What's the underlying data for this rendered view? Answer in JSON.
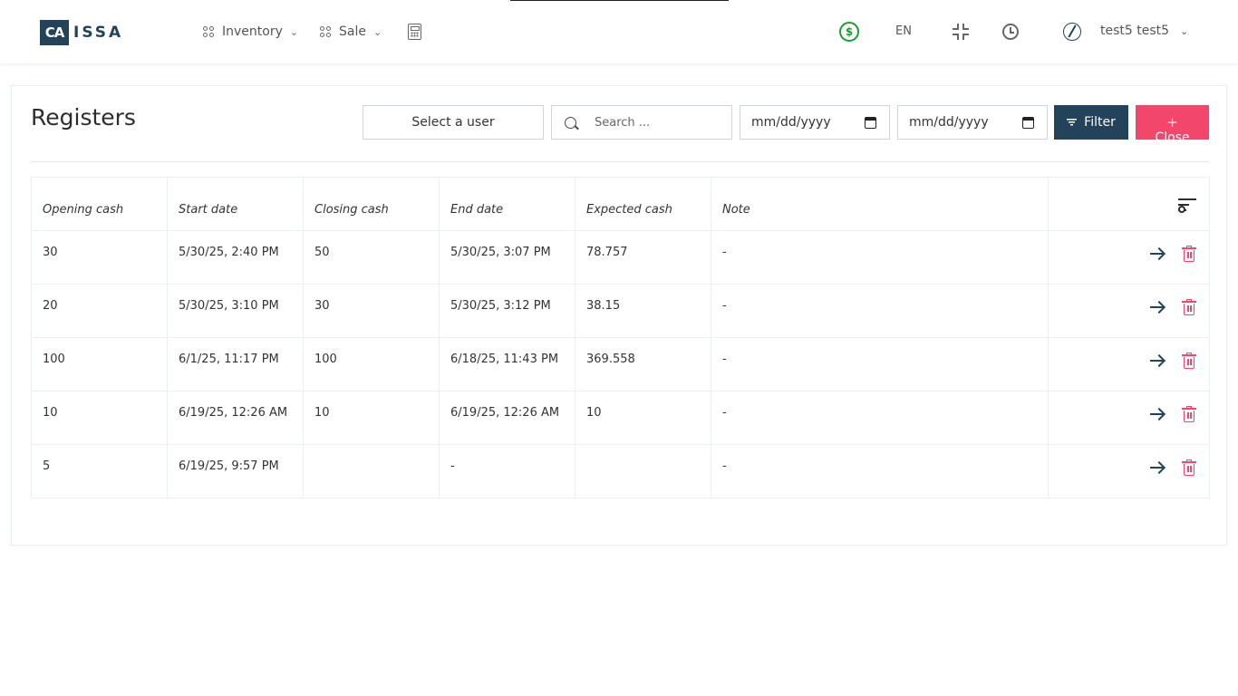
{
  "header": {
    "logo_mark": "CA",
    "logo_text": "ISSA",
    "nav": [
      {
        "label": "Inventory"
      },
      {
        "label": "Sale"
      }
    ],
    "sync_symbol": "$",
    "language": "EN",
    "user_name": "test5 test5"
  },
  "page": {
    "title": "Registers",
    "select_user_label": "Select a user",
    "search_placeholder": "Search ...",
    "date_from_placeholder": "mm/dd/yyyy",
    "date_to_placeholder": "mm/dd/yyyy",
    "filter_label": "Filter",
    "close_plus": "+",
    "close_label": "Close"
  },
  "table": {
    "columns": [
      "Opening cash",
      "Start date",
      "Closing cash",
      "End date",
      "Expected cash",
      "Note"
    ],
    "rows": [
      {
        "opening_cash": "30",
        "start_date": "5/30/25, 2:40 PM",
        "closing_cash": "50",
        "end_date": "5/30/25, 3:07 PM",
        "expected_cash": "78.757",
        "note": "-"
      },
      {
        "opening_cash": "20",
        "start_date": "5/30/25, 3:10 PM",
        "closing_cash": "30",
        "end_date": "5/30/25, 3:12 PM",
        "expected_cash": "38.15",
        "note": "-"
      },
      {
        "opening_cash": "100",
        "start_date": "6/1/25, 11:17 PM",
        "closing_cash": "100",
        "end_date": "6/18/25, 11:43 PM",
        "expected_cash": "369.558",
        "note": "-"
      },
      {
        "opening_cash": "10",
        "start_date": "6/19/25, 12:26 AM",
        "closing_cash": "10",
        "end_date": "6/19/25, 12:26 AM",
        "expected_cash": "10",
        "note": "-"
      },
      {
        "opening_cash": "5",
        "start_date": "6/19/25, 9:57 PM",
        "closing_cash": "",
        "end_date": "-",
        "expected_cash": "",
        "note": "-"
      }
    ]
  },
  "colors": {
    "brand": "#23435a",
    "danger": "#f2466a",
    "sync": "#18a02e"
  }
}
